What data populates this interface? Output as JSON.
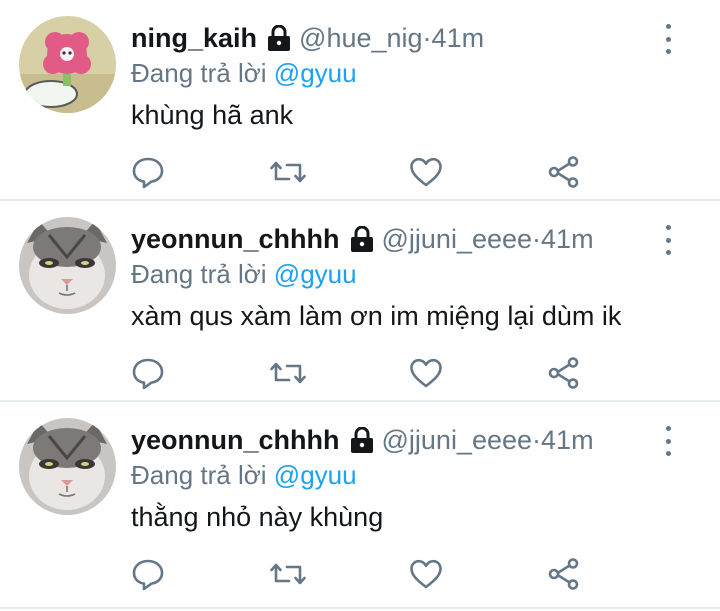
{
  "replies": [
    {
      "name": "ning_kaih",
      "handle": "@hue_nig",
      "time": "41m",
      "replying_prefix": "Đang trả lời",
      "replying_to": "@gyuu",
      "text": "khùng hã ank",
      "avatar": "cartoon-avatar"
    },
    {
      "name": "yeonnun_chhhh",
      "handle": "@jjuni_eeee",
      "time": "41m",
      "replying_prefix": "Đang trả lời",
      "replying_to": "@gyuu",
      "text": "xàm qus xàm làm ơn im miệng lại dùm ik",
      "avatar": "cat-avatar"
    },
    {
      "name": "yeonnun_chhhh",
      "handle": "@jjuni_eeee",
      "time": "41m",
      "replying_prefix": "Đang trả lời",
      "replying_to": "@gyuu",
      "text": "thằng nhỏ này khùng",
      "avatar": "cat-avatar"
    }
  ],
  "separator": " · ",
  "icons": {
    "private": "lock-icon",
    "more": "more-vertical-icon",
    "reply": "reply-icon",
    "retweet": "retweet-icon",
    "like": "heart-icon",
    "share": "share-icon"
  },
  "colors": {
    "mention": "#1da1f2",
    "secondary_text": "#657786",
    "primary_text": "#14171a",
    "divider": "#e6ecf0"
  }
}
